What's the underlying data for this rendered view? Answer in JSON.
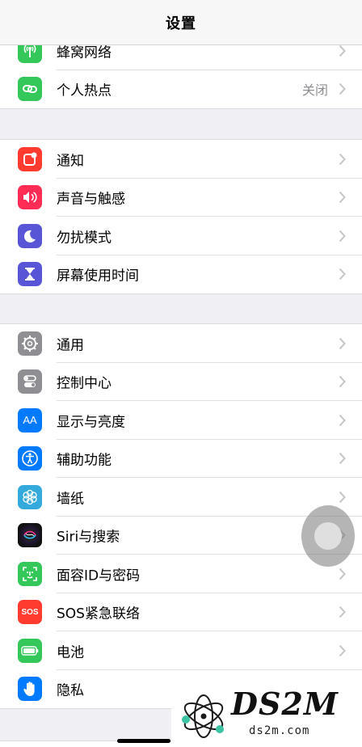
{
  "nav": {
    "title": "设置"
  },
  "colors": {
    "cellular": "#34c759",
    "hotspot": "#34c759",
    "notifications": "#ff3b30",
    "sounds": "#ff2d55",
    "dnd": "#5856d6",
    "screentime": "#5856d6",
    "general": "#8e8e93",
    "control": "#8e8e93",
    "display": "#007aff",
    "accessibility": "#007aff",
    "wallpaper": "#34aadc",
    "siri": "#222",
    "faceid": "#34c759",
    "sos": "#ff3b30",
    "battery": "#34c759",
    "privacy": "#007aff"
  },
  "group1": [
    {
      "label": "蜂窝网络",
      "icon": "antenna-icon"
    },
    {
      "label": "个人热点",
      "icon": "hotspot-icon",
      "value": "关闭"
    }
  ],
  "group2": [
    {
      "label": "通知",
      "icon": "notifications-icon"
    },
    {
      "label": "声音与触感",
      "icon": "speaker-icon"
    },
    {
      "label": "勿扰模式",
      "icon": "moon-icon"
    },
    {
      "label": "屏幕使用时间",
      "icon": "hourglass-icon"
    }
  ],
  "group3": [
    {
      "label": "通用",
      "icon": "gear-icon"
    },
    {
      "label": "控制中心",
      "icon": "toggles-icon"
    },
    {
      "label": "显示与亮度",
      "icon": "text-size-icon"
    },
    {
      "label": "辅助功能",
      "icon": "accessibility-icon"
    },
    {
      "label": "墙纸",
      "icon": "flower-icon"
    },
    {
      "label": "Siri与搜索",
      "icon": "siri-icon"
    },
    {
      "label": "面容ID与密码",
      "icon": "faceid-icon"
    },
    {
      "label": "SOS紧急联络",
      "icon": "sos-icon"
    },
    {
      "label": "电池",
      "icon": "battery-icon"
    },
    {
      "label": "隐私",
      "icon": "hand-icon"
    }
  ],
  "icon_text": {
    "display": "AA",
    "sos": "SOS"
  },
  "watermark": {
    "logo": "DS2M",
    "domain": "ds2m.com"
  }
}
